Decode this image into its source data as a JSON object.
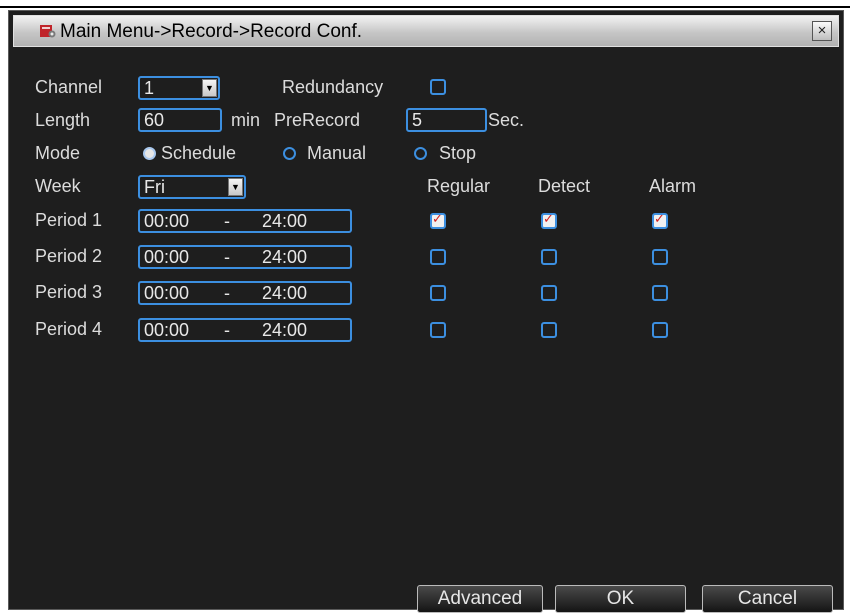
{
  "window": {
    "title": "Main Menu->Record->Record Conf.",
    "close_label": "×"
  },
  "form": {
    "channel_label": "Channel",
    "channel_value": "1",
    "redundancy_label": "Redundancy",
    "redundancy_checked": false,
    "length_label": "Length",
    "length_value": "60",
    "length_unit": "min",
    "prerecord_label": "PreRecord",
    "prerecord_value": "5",
    "prerecord_unit": "Sec.",
    "mode_label": "Mode",
    "mode_options": [
      "Schedule",
      "Manual",
      "Stop"
    ],
    "mode_selected": "Schedule",
    "week_label": "Week",
    "week_value": "Fri"
  },
  "columns": {
    "regular": "Regular",
    "detect": "Detect",
    "alarm": "Alarm"
  },
  "periods": [
    {
      "label": "Period 1",
      "start": "00:00",
      "sep": "-",
      "end": "24:00",
      "regular": true,
      "detect": true,
      "alarm": true
    },
    {
      "label": "Period 2",
      "start": "00:00",
      "sep": "-",
      "end": "24:00",
      "regular": false,
      "detect": false,
      "alarm": false
    },
    {
      "label": "Period 3",
      "start": "00:00",
      "sep": "-",
      "end": "24:00",
      "regular": false,
      "detect": false,
      "alarm": false
    },
    {
      "label": "Period 4",
      "start": "00:00",
      "sep": "-",
      "end": "24:00",
      "regular": false,
      "detect": false,
      "alarm": false
    }
  ],
  "buttons": {
    "advanced": "Advanced",
    "ok": "OK",
    "cancel": "Cancel"
  },
  "icons": {
    "title": "record-app-icon",
    "close": "close-icon",
    "dropdown": "chevron-down-icon"
  },
  "colors": {
    "accent": "#3c8fe0",
    "background": "#1e1e1e",
    "check": "#d21e1e"
  }
}
